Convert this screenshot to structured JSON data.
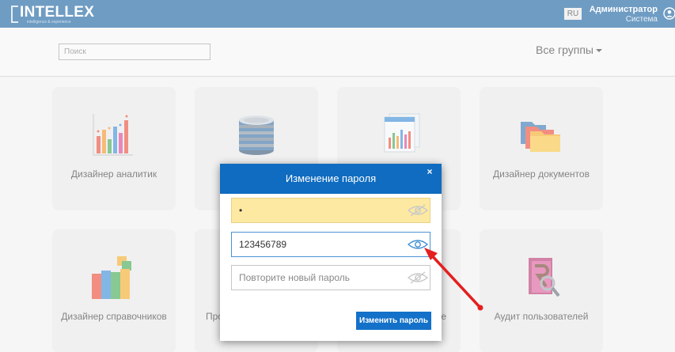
{
  "header": {
    "logo_text": "INTELLEX",
    "logo_subtitle": "intelligence & experience",
    "lang": "RU",
    "user_name": "Администратор",
    "user_role": "Система"
  },
  "search": {
    "placeholder": "Поиск",
    "value": ""
  },
  "groups_label": "Все группы",
  "tiles": [
    {
      "label": "Дизайнер аналитик"
    },
    {
      "label": ""
    },
    {
      "label": "х"
    },
    {
      "label": "Дизайнер документов"
    },
    {
      "label": "Дизайнер справочников"
    },
    {
      "label": "Про"
    },
    {
      "label": "е"
    },
    {
      "label": "Аудит пользователей"
    }
  ],
  "modal": {
    "title": "Изменение пароля",
    "close": "×",
    "field1_value": "•",
    "field2_value": "123456789",
    "field3_placeholder": "Повторите новый пароль",
    "submit_label": "Изменить пароль"
  },
  "colors": {
    "header_bg": "#0f5a9c",
    "modal_head": "#0f6cc0",
    "button": "#1371c9",
    "autofill": "#fde9a1",
    "arrow": "#e41f1f"
  }
}
